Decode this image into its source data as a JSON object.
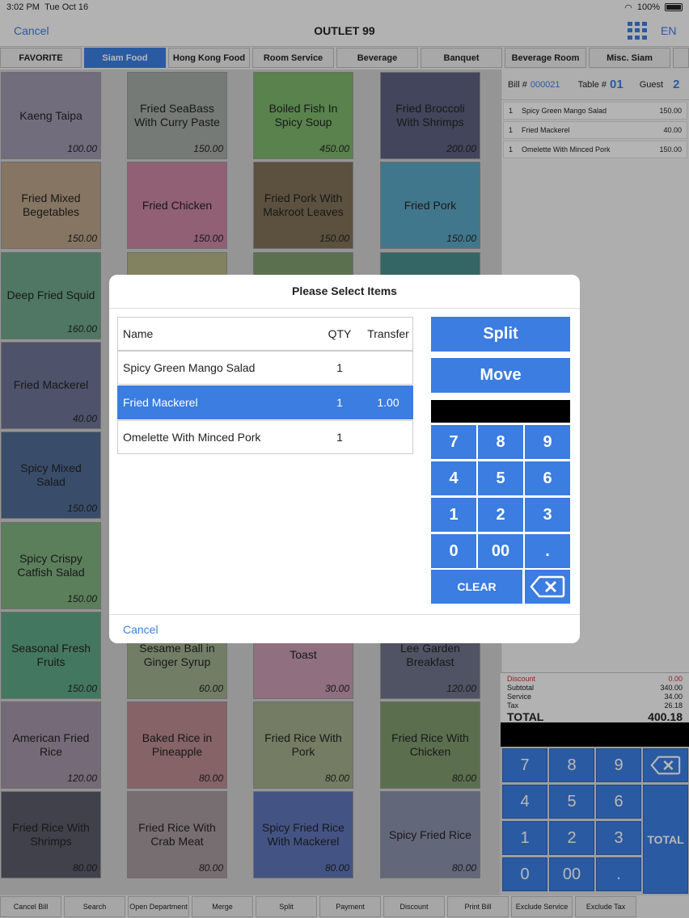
{
  "status": {
    "time": "3:02 PM",
    "date": "Tue Oct 16",
    "battery": "100%"
  },
  "nav": {
    "cancel": "Cancel",
    "title": "OUTLET 99",
    "lang": "EN"
  },
  "tabs": [
    "FAVORITE",
    "Siam Food",
    "Hong Kong Food",
    "Room Service",
    "Beverage",
    "Banquet",
    "Beverage Room",
    "Misc. Siam"
  ],
  "active_tab": "Siam Food",
  "menu_items": [
    {
      "name": "Kaeng Taipa",
      "price": "100.00",
      "color": "#9f97ae"
    },
    {
      "name": "Fried SeaBass With Curry Paste",
      "price": "150.00",
      "color": "#a3aaa4"
    },
    {
      "name": "Boiled Fish In Spicy Soup",
      "price": "450.00",
      "color": "#7cb46b"
    },
    {
      "name": "Fried Broccoli With Shrimps",
      "price": "200.00",
      "color": "#5c607f"
    },
    {
      "name": "Fried Mixed Begetables",
      "price": "150.00",
      "color": "#b9a388"
    },
    {
      "name": "Fried Chicken",
      "price": "150.00",
      "color": "#c985a1"
    },
    {
      "name": "Fried Pork With Makroot Leaves",
      "price": "150.00",
      "color": "#7f7156"
    },
    {
      "name": "Fried Pork",
      "price": "150.00",
      "color": "#5ba6c3"
    },
    {
      "name": "Deep Fried Squid",
      "price": "160.00",
      "color": "#6ea68a"
    },
    {
      "name": "",
      "price": "",
      "color": "#b5b585"
    },
    {
      "name": "",
      "price": "",
      "color": "#7f9b6e"
    },
    {
      "name": "",
      "price": "",
      "color": "#4a8e8e"
    },
    {
      "name": "Fried Mackerel",
      "price": "40.00",
      "color": "#6d7495"
    },
    {
      "name": "",
      "price": "",
      "color": "#a89a82"
    },
    {
      "name": "",
      "price": "",
      "color": "#8a9a78"
    },
    {
      "name": "",
      "price": "",
      "color": "#6f86a8"
    },
    {
      "name": "Spicy Mixed Salad",
      "price": "150.00",
      "color": "#4f6b93"
    },
    {
      "name": "",
      "price": "",
      "color": "#9a8fa5"
    },
    {
      "name": "",
      "price": "",
      "color": "#b07f8e"
    },
    {
      "name": "",
      "price": "",
      "color": "#7d9a9e"
    },
    {
      "name": "Spicy Crispy Catfish Salad",
      "price": "150.00",
      "color": "#7fb07e"
    },
    {
      "name": "",
      "price": "",
      "color": "#a5a57e"
    },
    {
      "name": "",
      "price": "",
      "color": "#8c7f9b"
    },
    {
      "name": "",
      "price": "",
      "color": "#6f8f7a"
    },
    {
      "name": "Seasonal Fresh Fruits",
      "price": "150.00",
      "color": "#5fa585"
    },
    {
      "name": "Sesame Ball in Ginger Syrup",
      "price": "60.00",
      "color": "#9fad8e"
    },
    {
      "name": "Toast",
      "price": "30.00",
      "color": "#c69ab2"
    },
    {
      "name": "Lee Garden Breakfast",
      "price": "120.00",
      "color": "#6f738a"
    },
    {
      "name": "American Fried Rice",
      "price": "120.00",
      "color": "#a394a7"
    },
    {
      "name": "Baked Rice in Pineapple",
      "price": "80.00",
      "color": "#b98a8e"
    },
    {
      "name": "Fried Rice With Pork",
      "price": "80.00",
      "color": "#a1ae8a"
    },
    {
      "name": "Fried Rice With Chicken",
      "price": "80.00",
      "color": "#7f9a6d"
    },
    {
      "name": "Fried Rice With Shrimps",
      "price": "80.00",
      "color": "#595a68"
    },
    {
      "name": "Fried Rice With Crab Meat",
      "price": "80.00",
      "color": "#a5999f"
    },
    {
      "name": "Spicy Fried Rice With Mackerel",
      "price": "80.00",
      "color": "#5e74b8"
    },
    {
      "name": "Spicy Fried Rice",
      "price": "80.00",
      "color": "#8a8fa9"
    }
  ],
  "bill": {
    "bill_label": "Bill #",
    "bill_no": "000021",
    "table_label": "Table #",
    "table_no": "01",
    "guest_label": "Guest",
    "guest_no": "2",
    "lines": [
      {
        "qty": "1",
        "name": "Spicy Green Mango Salad",
        "amount": "150.00"
      },
      {
        "qty": "1",
        "name": "Fried Mackerel",
        "amount": "40.00"
      },
      {
        "qty": "1",
        "name": "Omelette With Minced Pork",
        "amount": "150.00"
      }
    ],
    "totals": {
      "discount_label": "Discount",
      "discount": "0.00",
      "subtotal_label": "Subtotal",
      "subtotal": "340.00",
      "service_label": "Service",
      "service": "34.00",
      "tax_label": "Tax",
      "tax": "26.18",
      "total_label": "TOTAL",
      "total": "400.18"
    },
    "keypad": [
      "7",
      "8",
      "9",
      "4",
      "5",
      "6",
      "1",
      "2",
      "3",
      "0",
      "00",
      "."
    ],
    "total_button": "TOTAL"
  },
  "bottom_bar": [
    "Cancel Bill",
    "Search",
    "Open Department",
    "Merge",
    "Split",
    "Payment",
    "Discount",
    "Print Bill",
    "Exclude Service",
    "Exclude Tax"
  ],
  "modal": {
    "title": "Please Select Items",
    "headers": {
      "name": "Name",
      "qty": "QTY",
      "transfer": "Transfer"
    },
    "rows": [
      {
        "name": "Spicy Green Mango Salad",
        "qty": "1",
        "transfer": ""
      },
      {
        "name": "Fried Mackerel",
        "qty": "1",
        "transfer": "1.00"
      },
      {
        "name": "Omelette With Minced Pork",
        "qty": "1",
        "transfer": ""
      }
    ],
    "selected_row": 1,
    "split_label": "Split",
    "move_label": "Move",
    "keypad": [
      "7",
      "8",
      "9",
      "4",
      "5",
      "6",
      "1",
      "2",
      "3",
      "0",
      "00",
      "."
    ],
    "clear_label": "CLEAR",
    "cancel_label": "Cancel"
  },
  "colors": {
    "accent": "#3b7de0"
  }
}
